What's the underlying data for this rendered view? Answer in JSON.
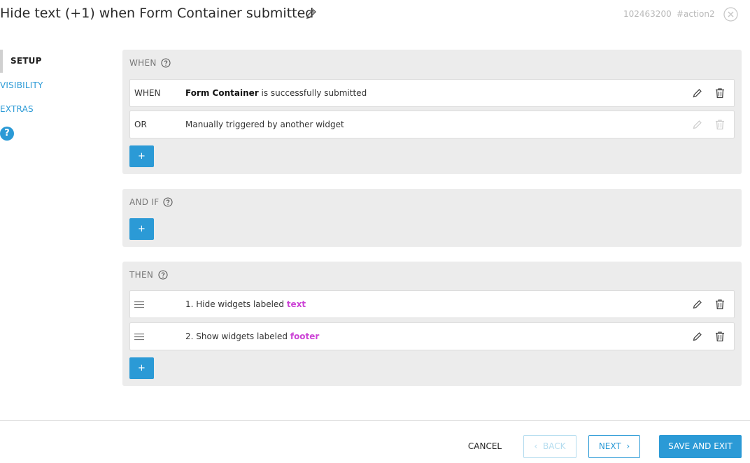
{
  "header": {
    "title": "Hide text (+1) when Form Container submitted",
    "edit_icon": "pencil-icon",
    "id": "102463200",
    "tag": "#action2",
    "close_icon": "close-circle-icon"
  },
  "nav": {
    "items": [
      {
        "label": "SETUP",
        "active": true
      },
      {
        "label": "VISIBILITY",
        "active": false
      },
      {
        "label": "EXTRAS",
        "active": false
      }
    ],
    "help_label": "?",
    "accent_color": "#2b9ad6"
  },
  "when": {
    "label": "WHEN",
    "rows": [
      {
        "keyword": "WHEN",
        "bold": "Form Container",
        "text": " is successfully submitted",
        "actions_enabled": true
      },
      {
        "keyword": "OR",
        "text": "Manually triggered by another widget",
        "actions_enabled": false
      }
    ],
    "add_label": "+"
  },
  "andif": {
    "label": "AND IF",
    "add_label": "+"
  },
  "then": {
    "label": "THEN",
    "rows": [
      {
        "prefix": "1. Hide widgets labeled ",
        "tag": "text"
      },
      {
        "prefix": "2. Show widgets labeled ",
        "tag": "footer"
      }
    ],
    "tag_color": "#cc44d6",
    "add_label": "+"
  },
  "footer": {
    "cancel": "CANCEL",
    "back": "BACK",
    "next": "NEXT",
    "save": "SAVE AND EXIT",
    "back_enabled": false
  }
}
